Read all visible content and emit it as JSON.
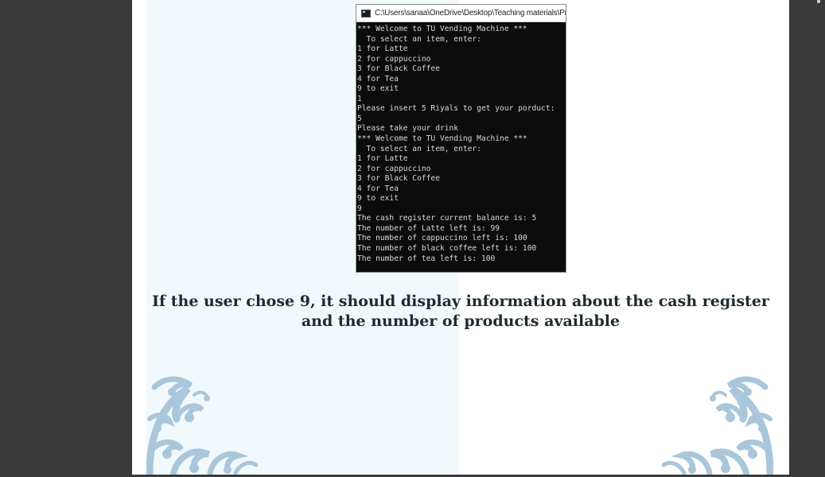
{
  "console": {
    "title": "C:\\Users\\sanaa\\OneDrive\\Desktop\\Teaching materials\\Prog",
    "lines": [
      "*** Welcome to TU Vending Machine ***",
      "  To select an item, enter:",
      "1 for Latte",
      "2 for cappuccino",
      "3 for Black Coffee",
      "4 for Tea",
      "9 to exit",
      "1",
      "Please insert 5 Riyals to get your porduct:",
      "5",
      "Please take your drink",
      "*** Welcome to TU Vending Machine ***",
      "  To select an item, enter:",
      "1 for Latte",
      "2 for cappuccino",
      "3 for Black Coffee",
      "4 for Tea",
      "9 to exit",
      "9",
      "The cash register current balance is: 5",
      "The number of Latte left is: 99",
      "The number of cappuccino left is: 100",
      "The number of black coffee left is: 100",
      "The number of tea left is: 100"
    ]
  },
  "caption": {
    "line1": "If the user chose 9, it should display information about the cash register",
    "line2": "and the number of products available"
  },
  "colors": {
    "viewer_background": "#3a3a3a",
    "slide_background": "#ffffff",
    "slide_tint": "#f2f9fd",
    "ornament": "#a9c6da",
    "caption_text": "#1d2b2f",
    "console_background": "#0c0c0c",
    "console_text": "#d8d8d8"
  },
  "icons": {
    "console_window": "console-window-icon",
    "ornament": "floral-swirl-ornament"
  }
}
